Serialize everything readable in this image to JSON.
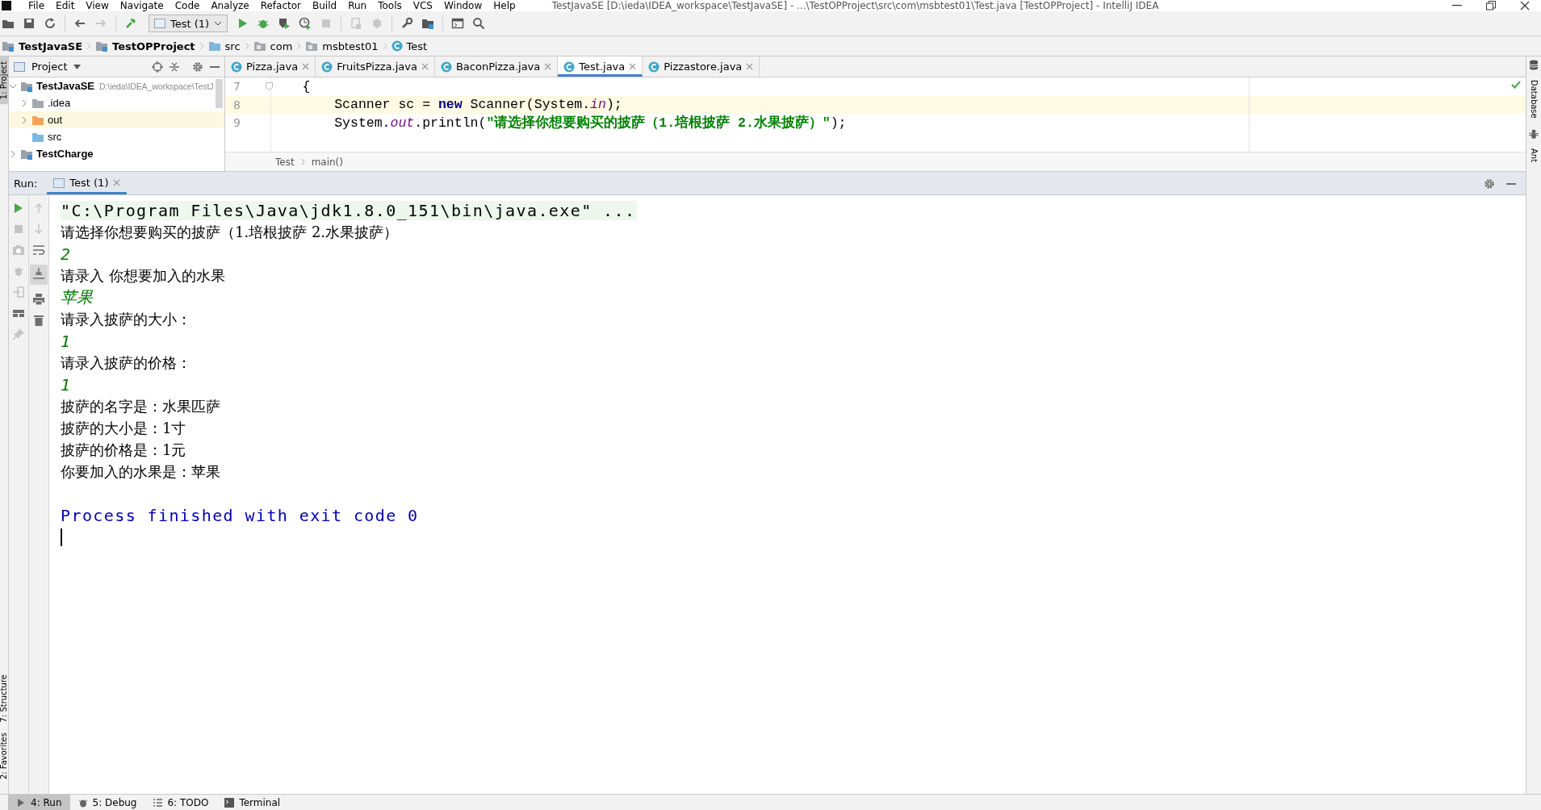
{
  "window": {
    "title": "TestJavaSE [D:\\ieda\\IDEA_workspace\\TestJavaSE] - ...\\TestOPProject\\src\\com\\msbtest01\\Test.java [TestOPProject] - IntelliJ IDEA"
  },
  "menu": [
    "File",
    "Edit",
    "View",
    "Navigate",
    "Code",
    "Analyze",
    "Refactor",
    "Build",
    "Run",
    "Tools",
    "VCS",
    "Window",
    "Help"
  ],
  "toolbar": {
    "run_configuration": "Test (1)"
  },
  "breadcrumb": [
    {
      "label": "TestJavaSE",
      "kind": "module"
    },
    {
      "label": "TestOPProject",
      "kind": "module"
    },
    {
      "label": "src",
      "kind": "source"
    },
    {
      "label": "com",
      "kind": "package"
    },
    {
      "label": "msbtest01",
      "kind": "package"
    },
    {
      "label": "Test",
      "kind": "class"
    }
  ],
  "left_stripe": {
    "top": [
      {
        "label": "1: Project",
        "selected": true
      }
    ],
    "bottom": [
      {
        "label": "7: Structure",
        "selected": false
      },
      {
        "label": "2: Favorites",
        "selected": false
      }
    ]
  },
  "right_stripe": [
    {
      "label": "Database",
      "kind": "database"
    },
    {
      "label": "Ant",
      "kind": "ant"
    }
  ],
  "project_panel": {
    "title": "Project",
    "tree": [
      {
        "label": "TestJavaSE",
        "path": "D:\\ieda\\IDEA_workspace\\TestJ",
        "kind": "module",
        "expanded": true,
        "selected": false,
        "children": [
          {
            "label": ".idea",
            "kind": "folder",
            "expanded": false,
            "selected": false
          },
          {
            "label": "out",
            "kind": "excluded",
            "expanded": false,
            "selected": true
          },
          {
            "label": "src",
            "kind": "source",
            "selected": false
          }
        ]
      },
      {
        "label": "TestCharge",
        "kind": "module",
        "expanded": false,
        "selected": false
      }
    ]
  },
  "editor": {
    "tabs": [
      {
        "label": "Pizza.java",
        "selected": false
      },
      {
        "label": "FruitsPizza.java",
        "selected": false
      },
      {
        "label": "BaconPizza.java",
        "selected": false
      },
      {
        "label": "Test.java",
        "selected": true
      },
      {
        "label": "Pizzastore.java",
        "selected": false
      }
    ],
    "lines": [
      {
        "number": "7",
        "current": false,
        "tokens": [
          {
            "text": "    {",
            "kind": "plain"
          }
        ]
      },
      {
        "number": "8",
        "current": true,
        "tokens": [
          {
            "text": "        Scanner sc = ",
            "kind": "plain"
          },
          {
            "text": "new",
            "kind": "keyword"
          },
          {
            "text": " Scanner(System.",
            "kind": "plain"
          },
          {
            "text": "in",
            "kind": "static"
          },
          {
            "text": ");",
            "kind": "plain"
          }
        ]
      },
      {
        "number": "9",
        "current": false,
        "tokens": [
          {
            "text": "        System.",
            "kind": "plain"
          },
          {
            "text": "out",
            "kind": "static"
          },
          {
            "text": ".println(",
            "kind": "plain"
          },
          {
            "text": "\"请选择你想要购买的披萨（1.培根披萨 2.水果披萨）\"",
            "kind": "string"
          },
          {
            "text": ");",
            "kind": "plain"
          }
        ]
      }
    ],
    "breadcrumb": [
      "Test",
      "main()"
    ]
  },
  "run_panel": {
    "title": "Run:",
    "tabs": [
      {
        "label": "Test (1)",
        "selected": true
      }
    ],
    "console": [
      {
        "kind": "command",
        "text": "\"C:\\Program Files\\Java\\jdk1.8.0_151\\bin\\java.exe\" ..."
      },
      {
        "kind": "output",
        "text": "请选择你想要购买的披萨（1.培根披萨 2.水果披萨）"
      },
      {
        "kind": "input",
        "text": "2"
      },
      {
        "kind": "output",
        "text": "请录入 你想要加入的水果"
      },
      {
        "kind": "input",
        "text": "苹果"
      },
      {
        "kind": "output",
        "text": "请录入披萨的大小："
      },
      {
        "kind": "input",
        "text": "1"
      },
      {
        "kind": "output",
        "text": "请录入披萨的价格："
      },
      {
        "kind": "input",
        "text": "1"
      },
      {
        "kind": "output",
        "text": "披萨的名字是：水果匹萨"
      },
      {
        "kind": "output",
        "text": "披萨的大小是：1寸"
      },
      {
        "kind": "output",
        "text": "披萨的价格是：1元"
      },
      {
        "kind": "output",
        "text": "你要加入的水果是：苹果"
      },
      {
        "kind": "blank"
      },
      {
        "kind": "exit",
        "text": "Process finished with exit code 0"
      }
    ]
  },
  "bottom_bar": [
    {
      "label": "4: Run",
      "kind": "run",
      "selected": true
    },
    {
      "label": "5: Debug",
      "kind": "debug",
      "selected": false
    },
    {
      "label": "6: TODO",
      "kind": "todo",
      "selected": false
    },
    {
      "label": "Terminal",
      "kind": "terminal",
      "selected": false
    }
  ]
}
